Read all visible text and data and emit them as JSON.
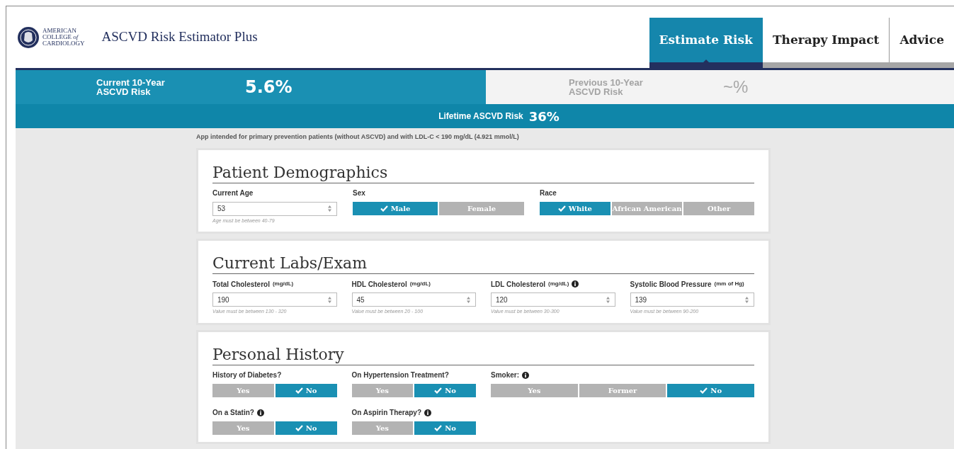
{
  "header": {
    "logo_lines": [
      "AMERICAN",
      "COLLEGE *of*",
      "CARDIOLOGY"
    ],
    "app_title": "ASCVD Risk Estimator Plus"
  },
  "tabs": [
    {
      "label": "Estimate Risk",
      "selected": true
    },
    {
      "label": "Therapy Impact",
      "selected": false
    },
    {
      "label": "Advice",
      "selected": false
    }
  ],
  "risk_bar": {
    "current": {
      "label_lines": [
        "Current 10-Year",
        "ASCVD Risk"
      ],
      "value": "5.6%"
    },
    "previous": {
      "label_lines": [
        "Previous 10-Year",
        "ASCVD Risk"
      ],
      "value": "~%"
    },
    "lifetime": {
      "label": "Lifetime ASCVD Risk",
      "value": "36%"
    }
  },
  "note": "App intended for primary prevention patients (without ASCVD) and with LDL-C < 190 mg/dL (4.921 mmol/L)",
  "sections": [
    {
      "title": "Patient Demographics",
      "fields": [
        {
          "kind": "number",
          "label": "Current Age",
          "info": false,
          "value": "53",
          "hint": "Age must be between 40-79"
        },
        {
          "kind": "choice",
          "label": "Sex",
          "info": false,
          "options": [
            {
              "label": "Male",
              "selected": true
            },
            {
              "label": "Female",
              "selected": false
            }
          ]
        },
        {
          "kind": "choice",
          "label": "Race",
          "info": false,
          "options": [
            {
              "label": "White",
              "selected": true
            },
            {
              "label": "African American",
              "selected": false
            },
            {
              "label": "Other",
              "selected": false
            }
          ]
        }
      ]
    },
    {
      "title": "Current Labs/Exam",
      "fields": [
        {
          "kind": "number",
          "label": "Total Cholesterol",
          "unit": "(mg/dL)",
          "info": false,
          "value": "190",
          "hint": "Value must be between 130 - 320"
        },
        {
          "kind": "number",
          "label": "HDL Cholesterol",
          "unit": "(mg/dL)",
          "info": false,
          "value": "45",
          "hint": "Value must be between 20 - 100"
        },
        {
          "kind": "number",
          "label": "LDL Cholesterol",
          "unit": "(mg/dL)",
          "info": true,
          "value": "120",
          "hint": "Value must be between 30-300"
        },
        {
          "kind": "number",
          "label": "Systolic Blood Pressure",
          "unit": "(mm of Hg)",
          "info": false,
          "value": "139",
          "hint": "Value must be between 90-200"
        }
      ]
    },
    {
      "title": "Personal History",
      "fields": [
        {
          "kind": "choice",
          "label": "History of Diabetes?",
          "info": false,
          "options": [
            {
              "label": "Yes",
              "selected": false
            },
            {
              "label": "No",
              "selected": true
            }
          ]
        },
        {
          "kind": "choice",
          "label": "On Hypertension Treatment?",
          "info": false,
          "options": [
            {
              "label": "Yes",
              "selected": false
            },
            {
              "label": "No",
              "selected": true
            }
          ]
        },
        {
          "kind": "choice",
          "label": "Smoker:",
          "info": true,
          "options": [
            {
              "label": "Yes",
              "selected": false
            },
            {
              "label": "Former",
              "selected": false
            },
            {
              "label": "No",
              "selected": true
            }
          ]
        },
        {
          "kind": "choice",
          "label": "On a Statin?",
          "info": true,
          "options": [
            {
              "label": "Yes",
              "selected": false
            },
            {
              "label": "No",
              "selected": true
            }
          ]
        },
        {
          "kind": "choice",
          "label": "On Aspirin Therapy?",
          "info": true,
          "options": [
            {
              "label": "Yes",
              "selected": false
            },
            {
              "label": "No",
              "selected": true
            }
          ]
        }
      ]
    }
  ]
}
